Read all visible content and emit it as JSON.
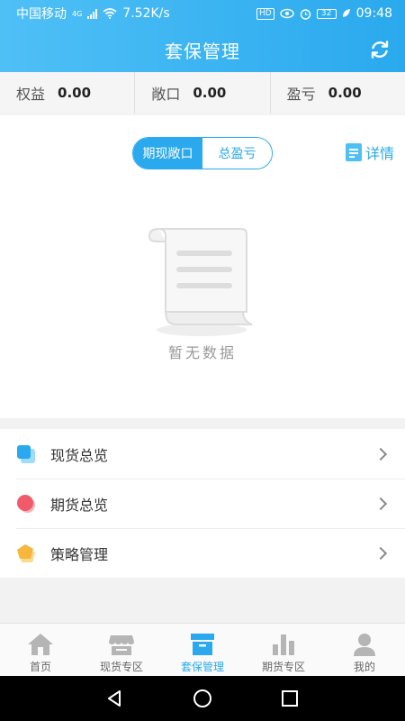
{
  "status_bar": {
    "carrier": "中国移动",
    "network_badge": "4G",
    "speed": "7.52K/s",
    "hd_badge": "HD",
    "battery": "32",
    "time": "09:48"
  },
  "header": {
    "title": "套保管理"
  },
  "summary": [
    {
      "label": "权益",
      "value": "0.00"
    },
    {
      "label": "敞口",
      "value": "0.00"
    },
    {
      "label": "盈亏",
      "value": "0.00"
    }
  ],
  "toggle": {
    "options": [
      "期现敞口",
      "总盈亏"
    ],
    "active_index": 0
  },
  "detail_label": "详情",
  "empty_text": "暂无数据",
  "menu": [
    {
      "label": "现货总览",
      "icon": "spot-overview-icon"
    },
    {
      "label": "期货总览",
      "icon": "futures-overview-icon"
    },
    {
      "label": "策略管理",
      "icon": "strategy-icon"
    }
  ],
  "tabs": [
    {
      "label": "首页",
      "icon": "home-icon"
    },
    {
      "label": "现货专区",
      "icon": "store-icon"
    },
    {
      "label": "套保管理",
      "icon": "box-icon"
    },
    {
      "label": "期货专区",
      "icon": "bar-chart-icon"
    },
    {
      "label": "我的",
      "icon": "user-icon"
    }
  ],
  "active_tab": 2,
  "colors": {
    "accent": "#2aa9ee",
    "header_gradient_start": "#4fc0f6",
    "menu_blue": "#2aa9ee",
    "menu_red": "#f15a6b",
    "menu_yellow": "#f7b73d"
  }
}
